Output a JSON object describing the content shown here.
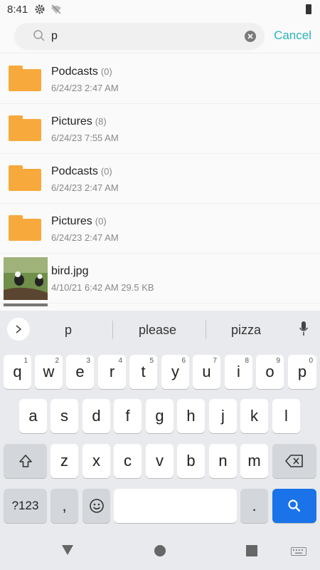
{
  "status": {
    "time": "8:41"
  },
  "search": {
    "query": "p",
    "cancel_label": "Cancel"
  },
  "files": [
    {
      "name": "Podcasts",
      "count": "(0)",
      "meta": "6/24/23 2:47 AM",
      "type": "folder"
    },
    {
      "name": "Pictures",
      "count": "(8)",
      "meta": "6/24/23 7:55 AM",
      "type": "folder"
    },
    {
      "name": "Podcasts",
      "count": "(0)",
      "meta": "6/24/23 2:47 AM",
      "type": "folder"
    },
    {
      "name": "Pictures",
      "count": "(0)",
      "meta": "6/24/23 2:47 AM",
      "type": "folder"
    },
    {
      "name": "bird.jpg",
      "count": "",
      "meta": "4/10/21 6:42 AM 29.5 KB",
      "type": "image"
    }
  ],
  "keyboard": {
    "suggestions": [
      "p",
      "please",
      "pizza"
    ],
    "row1": [
      [
        "q",
        "1"
      ],
      [
        "w",
        "2"
      ],
      [
        "e",
        "3"
      ],
      [
        "r",
        "4"
      ],
      [
        "t",
        "5"
      ],
      [
        "y",
        "6"
      ],
      [
        "u",
        "7"
      ],
      [
        "i",
        "8"
      ],
      [
        "o",
        "9"
      ],
      [
        "p",
        "0"
      ]
    ],
    "row2": [
      "a",
      "s",
      "d",
      "f",
      "g",
      "h",
      "j",
      "k",
      "l"
    ],
    "row3": [
      "z",
      "x",
      "c",
      "v",
      "b",
      "n",
      "m"
    ],
    "symbols_label": "?123",
    "comma": ",",
    "period": "."
  }
}
